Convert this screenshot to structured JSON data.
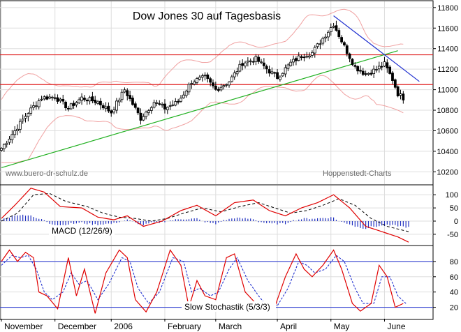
{
  "chart_data": [
    {
      "panel": "price",
      "type": "candlestick",
      "title": "Dow Jones 30 auf Tagesbasis",
      "watermark_left": "www.buero-dr-schulz.de",
      "watermark_right": "Hoppenstedt-Charts",
      "y_ticks": [
        10200,
        10400,
        10600,
        10800,
        11000,
        11200,
        11400,
        11600,
        11800
      ],
      "ylim": [
        10080,
        11860
      ],
      "x_month_labels": [
        "November",
        "December",
        "2006",
        "February",
        "March",
        "April",
        "May",
        "June"
      ],
      "x_month_day_positions": [
        0,
        20,
        41,
        61,
        80,
        103,
        123,
        143
      ],
      "support_lines": [
        11050,
        11340
      ],
      "uptrend_line": {
        "start": {
          "day": 0,
          "value": 10240
        },
        "end": {
          "day": 148,
          "value": 11380
        }
      },
      "downtrend_line": {
        "start": {
          "day": 124,
          "value": 11720
        },
        "end": {
          "day": 156,
          "value": 11080
        }
      },
      "close_keypoints": [
        {
          "day": 0,
          "value": 10430
        },
        {
          "day": 5,
          "value": 10600
        },
        {
          "day": 10,
          "value": 10780
        },
        {
          "day": 15,
          "value": 10920
        },
        {
          "day": 20,
          "value": 10930
        },
        {
          "day": 25,
          "value": 10820
        },
        {
          "day": 30,
          "value": 10920
        },
        {
          "day": 36,
          "value": 10880
        },
        {
          "day": 41,
          "value": 10780
        },
        {
          "day": 46,
          "value": 11000
        },
        {
          "day": 52,
          "value": 10720
        },
        {
          "day": 57,
          "value": 10880
        },
        {
          "day": 61,
          "value": 10820
        },
        {
          "day": 66,
          "value": 10880
        },
        {
          "day": 71,
          "value": 11080
        },
        {
          "day": 76,
          "value": 11120
        },
        {
          "day": 80,
          "value": 11000
        },
        {
          "day": 85,
          "value": 11080
        },
        {
          "day": 90,
          "value": 11260
        },
        {
          "day": 95,
          "value": 11300
        },
        {
          "day": 100,
          "value": 11180
        },
        {
          "day": 103,
          "value": 11120
        },
        {
          "day": 108,
          "value": 11260
        },
        {
          "day": 112,
          "value": 11330
        },
        {
          "day": 116,
          "value": 11360
        },
        {
          "day": 120,
          "value": 11500
        },
        {
          "day": 124,
          "value": 11640
        },
        {
          "day": 128,
          "value": 11420
        },
        {
          "day": 132,
          "value": 11220
        },
        {
          "day": 136,
          "value": 11150
        },
        {
          "day": 140,
          "value": 11200
        },
        {
          "day": 143,
          "value": 11250
        },
        {
          "day": 146,
          "value": 11100
        },
        {
          "day": 148,
          "value": 10960
        },
        {
          "day": 150,
          "value": 10920
        }
      ]
    },
    {
      "panel": "macd",
      "type": "line",
      "label": "MACD (12/26/9)",
      "y_ticks": [
        100,
        50,
        0,
        -50
      ],
      "ylim": [
        -90,
        135
      ],
      "macd_keypoints": [
        {
          "day": 0,
          "value": 10
        },
        {
          "day": 5,
          "value": 60
        },
        {
          "day": 11,
          "value": 125
        },
        {
          "day": 16,
          "value": 110
        },
        {
          "day": 22,
          "value": 55
        },
        {
          "day": 30,
          "value": 50
        },
        {
          "day": 36,
          "value": 15
        },
        {
          "day": 42,
          "value": 5
        },
        {
          "day": 47,
          "value": 20
        },
        {
          "day": 53,
          "value": -20
        },
        {
          "day": 60,
          "value": 0
        },
        {
          "day": 67,
          "value": 40
        },
        {
          "day": 73,
          "value": 60
        },
        {
          "day": 80,
          "value": 20
        },
        {
          "day": 87,
          "value": 70
        },
        {
          "day": 94,
          "value": 80
        },
        {
          "day": 100,
          "value": 40
        },
        {
          "day": 106,
          "value": 20
        },
        {
          "day": 112,
          "value": 50
        },
        {
          "day": 118,
          "value": 70
        },
        {
          "day": 124,
          "value": 100
        },
        {
          "day": 130,
          "value": 50
        },
        {
          "day": 136,
          "value": -20
        },
        {
          "day": 142,
          "value": -40
        },
        {
          "day": 148,
          "value": -60
        },
        {
          "day": 152,
          "value": -80
        }
      ],
      "signal_keypoints": [
        {
          "day": 0,
          "value": 0
        },
        {
          "day": 6,
          "value": 30
        },
        {
          "day": 12,
          "value": 100
        },
        {
          "day": 18,
          "value": 105
        },
        {
          "day": 24,
          "value": 75
        },
        {
          "day": 32,
          "value": 55
        },
        {
          "day": 38,
          "value": 30
        },
        {
          "day": 44,
          "value": 15
        },
        {
          "day": 50,
          "value": 10
        },
        {
          "day": 56,
          "value": 0
        },
        {
          "day": 62,
          "value": 10
        },
        {
          "day": 68,
          "value": 30
        },
        {
          "day": 75,
          "value": 50
        },
        {
          "day": 82,
          "value": 35
        },
        {
          "day": 89,
          "value": 55
        },
        {
          "day": 96,
          "value": 70
        },
        {
          "day": 102,
          "value": 50
        },
        {
          "day": 108,
          "value": 30
        },
        {
          "day": 114,
          "value": 40
        },
        {
          "day": 120,
          "value": 60
        },
        {
          "day": 126,
          "value": 85
        },
        {
          "day": 132,
          "value": 60
        },
        {
          "day": 138,
          "value": 10
        },
        {
          "day": 144,
          "value": -20
        },
        {
          "day": 152,
          "value": -40
        }
      ]
    },
    {
      "panel": "stochastic",
      "type": "line",
      "label": "Slow Stochastik (5/3/3)",
      "y_ticks": [
        80,
        60,
        40,
        20
      ],
      "ylim": [
        5,
        100
      ],
      "reference_lines": [
        80,
        20
      ],
      "k_keypoints": [
        {
          "day": 0,
          "value": 80
        },
        {
          "day": 3,
          "value": 95
        },
        {
          "day": 6,
          "value": 80
        },
        {
          "day": 9,
          "value": 92
        },
        {
          "day": 12,
          "value": 85
        },
        {
          "day": 14,
          "value": 40
        },
        {
          "day": 17,
          "value": 35
        },
        {
          "day": 21,
          "value": 18
        },
        {
          "day": 25,
          "value": 85
        },
        {
          "day": 28,
          "value": 35
        },
        {
          "day": 31,
          "value": 70
        },
        {
          "day": 35,
          "value": 12
        },
        {
          "day": 39,
          "value": 65
        },
        {
          "day": 44,
          "value": 95
        },
        {
          "day": 47,
          "value": 85
        },
        {
          "day": 50,
          "value": 30
        },
        {
          "day": 54,
          "value": 14
        },
        {
          "day": 58,
          "value": 40
        },
        {
          "day": 63,
          "value": 95
        },
        {
          "day": 67,
          "value": 75
        },
        {
          "day": 70,
          "value": 20
        },
        {
          "day": 73,
          "value": 55
        },
        {
          "day": 76,
          "value": 35
        },
        {
          "day": 80,
          "value": 30
        },
        {
          "day": 84,
          "value": 85
        },
        {
          "day": 87,
          "value": 90
        },
        {
          "day": 91,
          "value": 40
        },
        {
          "day": 95,
          "value": 25
        },
        {
          "day": 98,
          "value": 15
        },
        {
          "day": 102,
          "value": 20
        },
        {
          "day": 106,
          "value": 60
        },
        {
          "day": 110,
          "value": 90
        },
        {
          "day": 113,
          "value": 70
        },
        {
          "day": 116,
          "value": 60
        },
        {
          "day": 120,
          "value": 75
        },
        {
          "day": 124,
          "value": 95
        },
        {
          "day": 127,
          "value": 70
        },
        {
          "day": 131,
          "value": 25
        },
        {
          "day": 134,
          "value": 15
        },
        {
          "day": 138,
          "value": 25
        },
        {
          "day": 141,
          "value": 75
        },
        {
          "day": 144,
          "value": 60
        },
        {
          "day": 147,
          "value": 20
        },
        {
          "day": 150,
          "value": 25
        }
      ],
      "d_keypoints": [
        {
          "day": 0,
          "value": 75
        },
        {
          "day": 4,
          "value": 88
        },
        {
          "day": 7,
          "value": 85
        },
        {
          "day": 10,
          "value": 88
        },
        {
          "day": 13,
          "value": 70
        },
        {
          "day": 16,
          "value": 40
        },
        {
          "day": 19,
          "value": 30
        },
        {
          "day": 23,
          "value": 40
        },
        {
          "day": 26,
          "value": 65
        },
        {
          "day": 29,
          "value": 50
        },
        {
          "day": 32,
          "value": 55
        },
        {
          "day": 36,
          "value": 30
        },
        {
          "day": 40,
          "value": 50
        },
        {
          "day": 45,
          "value": 85
        },
        {
          "day": 48,
          "value": 80
        },
        {
          "day": 51,
          "value": 45
        },
        {
          "day": 55,
          "value": 25
        },
        {
          "day": 59,
          "value": 40
        },
        {
          "day": 64,
          "value": 85
        },
        {
          "day": 68,
          "value": 80
        },
        {
          "day": 71,
          "value": 40
        },
        {
          "day": 74,
          "value": 45
        },
        {
          "day": 78,
          "value": 35
        },
        {
          "day": 81,
          "value": 40
        },
        {
          "day": 85,
          "value": 70
        },
        {
          "day": 88,
          "value": 85
        },
        {
          "day": 92,
          "value": 55
        },
        {
          "day": 96,
          "value": 35
        },
        {
          "day": 99,
          "value": 22
        },
        {
          "day": 103,
          "value": 22
        },
        {
          "day": 107,
          "value": 45
        },
        {
          "day": 111,
          "value": 80
        },
        {
          "day": 114,
          "value": 75
        },
        {
          "day": 117,
          "value": 65
        },
        {
          "day": 121,
          "value": 70
        },
        {
          "day": 125,
          "value": 88
        },
        {
          "day": 128,
          "value": 80
        },
        {
          "day": 132,
          "value": 45
        },
        {
          "day": 135,
          "value": 25
        },
        {
          "day": 139,
          "value": 25
        },
        {
          "day": 142,
          "value": 60
        },
        {
          "day": 145,
          "value": 60
        },
        {
          "day": 148,
          "value": 35
        },
        {
          "day": 151,
          "value": 25
        }
      ]
    }
  ],
  "colors": {
    "support": "#e02020",
    "uptrend": "#20b020",
    "downtrend": "#2030d0",
    "bollinger": "#f0a0a0",
    "macd": "#e00000",
    "signal": "#000000",
    "histogram": "#2030c0",
    "stoch_k": "#e00000",
    "stoch_d": "#2030d0",
    "stoch_ref": "#2030d0"
  }
}
